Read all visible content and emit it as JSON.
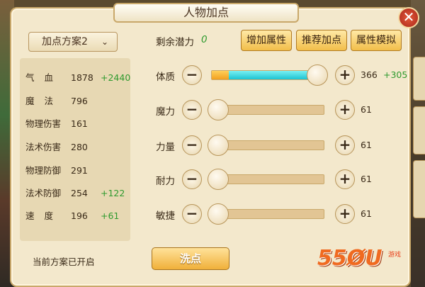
{
  "window": {
    "title": "人物加点",
    "close_icon": "✕"
  },
  "plan_selector": {
    "selected": "加点方案2",
    "chevron": "⌄"
  },
  "stats": [
    {
      "label": "气血",
      "value": "1878",
      "bonus": "+2440",
      "spaced": true
    },
    {
      "label": "魔法",
      "value": "796",
      "bonus": "",
      "spaced": true
    },
    {
      "label": "物理伤害",
      "value": "161",
      "bonus": "",
      "spaced": false
    },
    {
      "label": "法术伤害",
      "value": "280",
      "bonus": "",
      "spaced": false
    },
    {
      "label": "物理防御",
      "value": "291",
      "bonus": "",
      "spaced": false
    },
    {
      "label": "法术防御",
      "value": "254",
      "bonus": "+122",
      "spaced": false
    },
    {
      "label": "速度",
      "value": "196",
      "bonus": "+61",
      "spaced": true
    }
  ],
  "status_text": "当前方案已开启",
  "potential": {
    "label": "剩余潜力",
    "value": "0"
  },
  "buttons": {
    "add_attr": "增加属性",
    "recommend": "推荐加点",
    "simulate": "属性模拟",
    "wash": "洗点"
  },
  "attributes": [
    {
      "name": "体质",
      "value": "366",
      "bonus": "+305",
      "fill_fraction": 1.0,
      "allocated_fraction": 0.85
    },
    {
      "name": "魔力",
      "value": "61",
      "bonus": "",
      "fill_fraction": 0.0,
      "allocated_fraction": 0.0
    },
    {
      "name": "力量",
      "value": "61",
      "bonus": "",
      "fill_fraction": 0.0,
      "allocated_fraction": 0.0
    },
    {
      "name": "耐力",
      "value": "61",
      "bonus": "",
      "fill_fraction": 0.0,
      "allocated_fraction": 0.0
    },
    {
      "name": "敏捷",
      "value": "61",
      "bonus": "",
      "fill_fraction": 0.0,
      "allocated_fraction": 0.0
    }
  ],
  "watermark": {
    "text": "55ØU",
    "sub": "游戏"
  },
  "colors": {
    "bonus_green": "#2e9a2e",
    "slider_cyan": "#1cc3d2",
    "slider_orange": "#f2a020",
    "close_red": "#c0301e"
  }
}
